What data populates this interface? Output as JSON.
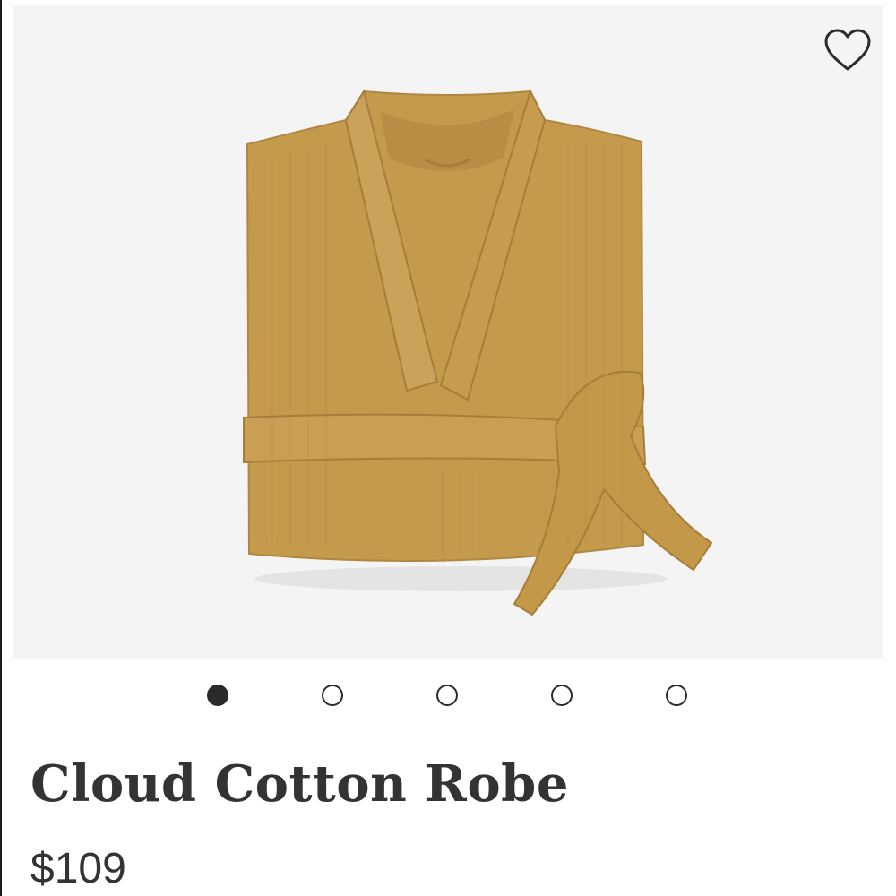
{
  "product": {
    "name": "Cloud Cotton Robe",
    "price": "$109",
    "image_color": "#C49A4C"
  },
  "gallery": {
    "slide_count": 5,
    "active_slide": 1,
    "favorite_icon": "heart-outline-icon"
  },
  "colors": {
    "text": "#333333",
    "gallery_bg": "#f4f4f4",
    "dot": "#2b2b2b"
  }
}
